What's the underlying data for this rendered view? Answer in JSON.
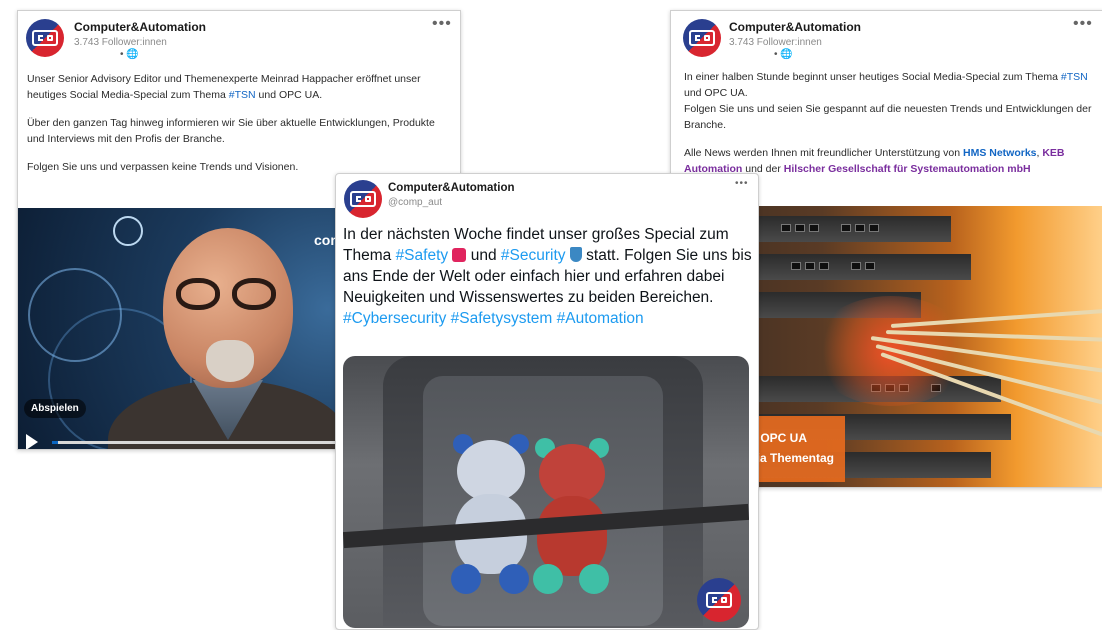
{
  "left_post": {
    "author": "Computer&Automation",
    "followers": "3.743 Follower:innen",
    "globe": "• 🌐",
    "menu": "•••",
    "p1_a": "Unser Senior Advisory Editor und Themenexperte Meinrad Happacher eröffnet unser heutiges Social Media-Special zum Thema ",
    "p1_tag": "#TSN",
    "p1_b": " und OPC UA.",
    "p2": "Über den ganzen Tag hinweg informieren wir Sie über aktuelle Entwicklungen, Produkte und Interviews mit den Profis der Branche.",
    "p3": "Folgen Sie uns und verpassen keine Trends und Visionen.",
    "video": {
      "play_label": "Abspielen",
      "corner_text": "com",
      "progress_fraction": 0.02
    }
  },
  "middle_tweet": {
    "author": "Computer&Automation",
    "handle": "@comp_aut",
    "menu": "•••",
    "t_a": "In der nächsten Woche findet unser großes Special zum Thema ",
    "tag_safety": "#Safety",
    "t_b": " und ",
    "tag_security": "#Security",
    "t_c": " statt. Folgen Sie uns bis ans Ende der Welt oder einfach hier und erfahren dabei Neuigkeiten und Wissenswertes zu beiden Bereichen.",
    "tags_line": "#Cybersecurity #Safetysystem #Automation"
  },
  "right_post": {
    "author": "Computer&Automation",
    "followers": "3.743 Follower:innen",
    "globe": "• 🌐",
    "menu": "•••",
    "p1_a": "In einer halben Stunde beginnt unser heutiges Social Media-Special zum Thema ",
    "p1_tag": "#TSN",
    "p1_b": " und OPC UA.",
    "p1_c": "Folgen Sie uns und seien Sie gespannt auf die neuesten Trends und Entwicklungen der Branche.",
    "p2_a": "Alle News werden Ihnen mit freundlicher Unterstützung von ",
    "sponsor1": "HMS Networks",
    "p2_b": ", ",
    "sponsor2": "KEB Automation",
    "p2_c": " und der ",
    "sponsor3": "Hilscher Gesellschaft für Systemautomation mbH",
    "badge_line1": "TSN & OPC UA",
    "badge_line2": "Social Media Thementag"
  },
  "colors": {
    "linkedin_link": "#1266c4",
    "twitter_link": "#1d9bf0",
    "logo_blue": "#2a3f8f",
    "logo_red": "#d8252f",
    "badge_orange": "#e66a1e"
  }
}
